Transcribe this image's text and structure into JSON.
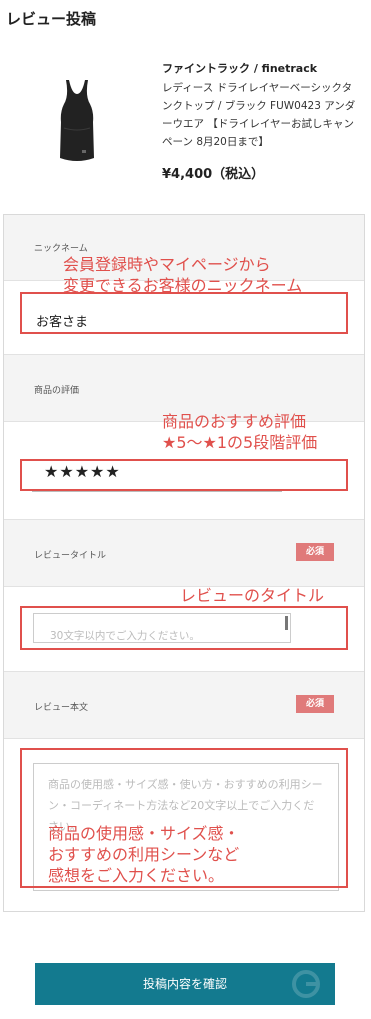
{
  "page": {
    "title": "レビュー投稿"
  },
  "product": {
    "brand": "ファイントラック / finetrack",
    "name": "レディース ドライレイヤーベーシックタンクトップ / ブラック FUW0423 アンダーウエア 【ドライレイヤーお試しキャンペーン 8月20日まで】",
    "price": "¥4,400（税込）"
  },
  "form": {
    "nickname": {
      "label": "ニックネーム",
      "value": "お客さま"
    },
    "rating": {
      "label": "商品の評価",
      "value": "★★★★★"
    },
    "title": {
      "label": "レビュータイトル",
      "required": "必須",
      "placeholder": "30文字以内でご入力ください。"
    },
    "body": {
      "label": "レビュー本文",
      "required": "必須",
      "placeholder": "商品の使用感・サイズ感・使い方・おすすめの利用シーン・コーディネート方法など20文字以上でご入力ください。"
    }
  },
  "annotations": {
    "nickname_line1": "会員登録時やマイページから",
    "nickname_line2": "変更できるお客様のニックネーム",
    "rating_line1": "商品のおすすめ評価",
    "rating_line2": "★5〜★1の5段階評価",
    "title_note": "レビューのタイトル",
    "body_line1": "商品の使用感・サイズ感・",
    "body_line2": "おすすめの利用シーンなど",
    "body_line3": "感想をご入力ください。"
  },
  "submit": {
    "label": "投稿内容を確認"
  },
  "colors": {
    "accent": "#137a8f",
    "annotation": "#e0504c",
    "required": "#e07a7a"
  }
}
